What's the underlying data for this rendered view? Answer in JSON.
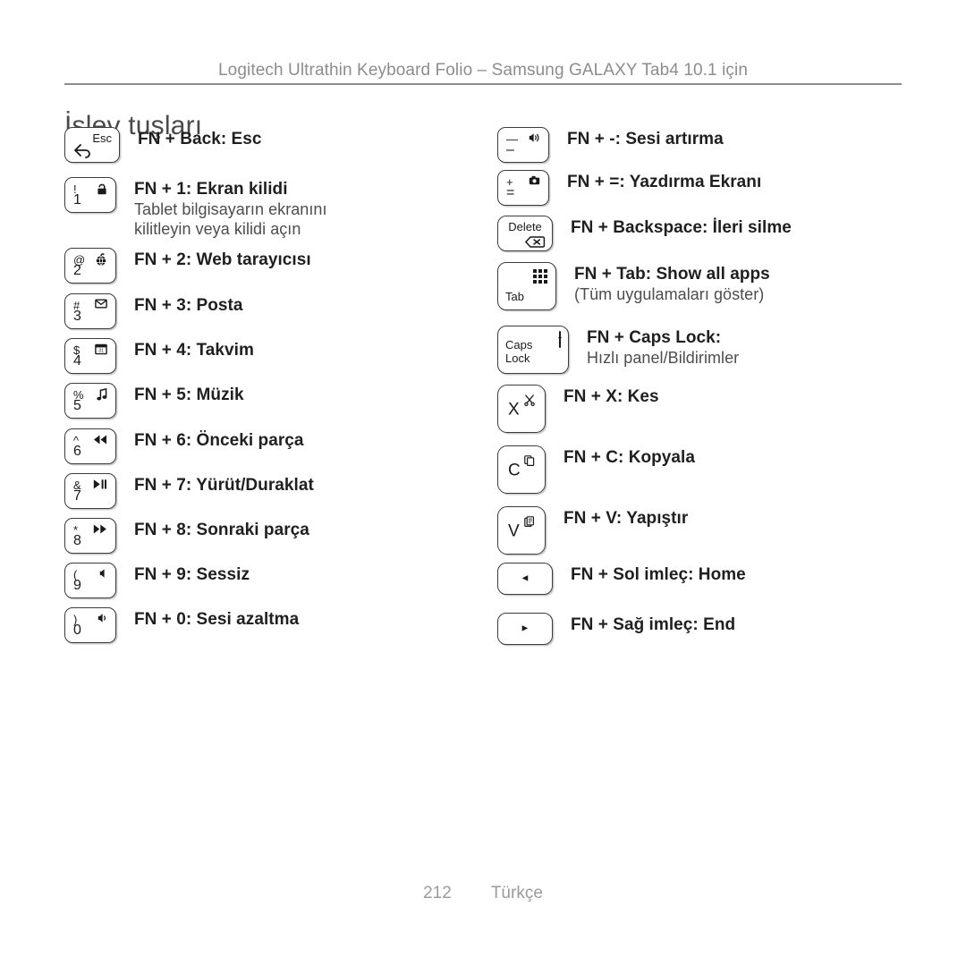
{
  "header": {
    "running_head": "Logitech Ultrathin Keyboard Folio – Samsung GALAXY Tab4 10.1 için",
    "page_title": "İşlev tuşları"
  },
  "footer": {
    "page_number": "212",
    "language": "Türkçe"
  },
  "colors": {
    "text": "#1f1f1f",
    "muted": "#8d8d8d",
    "subtext": "#4d4d4d",
    "key_border": "#3c3c3c"
  },
  "left_column": [
    {
      "key": {
        "type": "esc",
        "top_right": "Esc",
        "bottom_left_icon": "back-arrow-icon"
      },
      "title": "FN + Back: Esc",
      "sub": ""
    },
    {
      "key": {
        "type": "num",
        "top_left": "!",
        "bottom_left": "1",
        "top_right_icon": "lock-icon"
      },
      "title": "FN + 1: Ekran kilidi",
      "sub": "Tablet bilgisayarın ekranını\nkilitleyin veya kilidi açın"
    },
    {
      "key": {
        "type": "num",
        "top_left": "@",
        "bottom_left": "2",
        "top_right_icon": "globe-browser-icon"
      },
      "title": "FN + 2: Web tarayıcısı",
      "sub": ""
    },
    {
      "key": {
        "type": "num",
        "top_left": "#",
        "bottom_left": "3",
        "top_right_icon": "envelope-mail-icon"
      },
      "title": "FN + 3: Posta",
      "sub": ""
    },
    {
      "key": {
        "type": "num",
        "top_left": "$",
        "bottom_left": "4",
        "top_right_icon": "calendar-icon"
      },
      "title": "FN + 4: Takvim",
      "sub": ""
    },
    {
      "key": {
        "type": "num",
        "top_left": "%",
        "bottom_left": "5",
        "top_right_icon": "music-note-icon"
      },
      "title": "FN + 5: Müzik",
      "sub": ""
    },
    {
      "key": {
        "type": "num",
        "top_left": "^",
        "bottom_left": "6",
        "top_right_icon": "previous-track-icon"
      },
      "title": "FN + 6: Önceki parça",
      "sub": ""
    },
    {
      "key": {
        "type": "num",
        "top_left": "&",
        "bottom_left": "7",
        "top_right_icon": "play-pause-icon"
      },
      "title": "FN + 7: Yürüt/Duraklat",
      "sub": ""
    },
    {
      "key": {
        "type": "num",
        "top_left": "*",
        "bottom_left": "8",
        "top_right_icon": "next-track-icon"
      },
      "title": "FN + 8: Sonraki parça",
      "sub": ""
    },
    {
      "key": {
        "type": "num",
        "top_left": "(",
        "bottom_left": "9",
        "top_right_icon": "mute-icon"
      },
      "title": "FN + 9: Sessiz",
      "sub": ""
    },
    {
      "key": {
        "type": "num",
        "top_left": ")",
        "bottom_left": "0",
        "top_right_icon": "volume-down-icon"
      },
      "title": "FN + 0: Sesi azaltma",
      "sub": ""
    }
  ],
  "right_column": [
    {
      "key": {
        "type": "num",
        "top_left": "—",
        "bottom_left": "–",
        "top_right_icon": "volume-up-icon"
      },
      "title": "FN + -: Sesi artırma",
      "sub": ""
    },
    {
      "key": {
        "type": "num",
        "top_left": "+",
        "bottom_left": "=",
        "top_right_icon": "camera-screenshot-icon"
      },
      "title": "FN + =: Yazdırma Ekranı",
      "sub": ""
    },
    {
      "key": {
        "type": "delete",
        "word": "Delete",
        "bottom_right_icon": "backspace-delete-icon"
      },
      "title": "FN + Backspace: İleri silme",
      "sub": ""
    },
    {
      "key": {
        "type": "tab",
        "word": "Tab",
        "top_right_icon": "apps-grid-icon"
      },
      "title": "FN + Tab: Show all apps",
      "sub": "(Tüm uygulamaları göster)"
    },
    {
      "key": {
        "type": "caps",
        "word": "Caps\nLock",
        "top_right_icon": "notification-panel-icon"
      },
      "title": "FN + Caps Lock:",
      "sub": "Hızlı panel/Bildirimler"
    },
    {
      "key": {
        "type": "letter",
        "letter": "X",
        "sup_icon": "scissors-cut-icon"
      },
      "title": "FN + X: Kes",
      "sub": ""
    },
    {
      "key": {
        "type": "letter",
        "letter": "C",
        "sup_icon": "copy-icon"
      },
      "title": "FN + C: Kopyala",
      "sub": ""
    },
    {
      "key": {
        "type": "letter",
        "letter": "V",
        "sup_icon": "paste-icon"
      },
      "title": "FN + V: Yapıştır",
      "sub": ""
    },
    {
      "key": {
        "type": "arrow",
        "icon": "left-arrow-icon",
        "glyph": "◄"
      },
      "title": "FN + Sol imleç: Home",
      "sub": ""
    },
    {
      "key": {
        "type": "arrow",
        "icon": "right-arrow-icon",
        "glyph": "►"
      },
      "title": "FN + Sağ imleç: End",
      "sub": ""
    }
  ]
}
